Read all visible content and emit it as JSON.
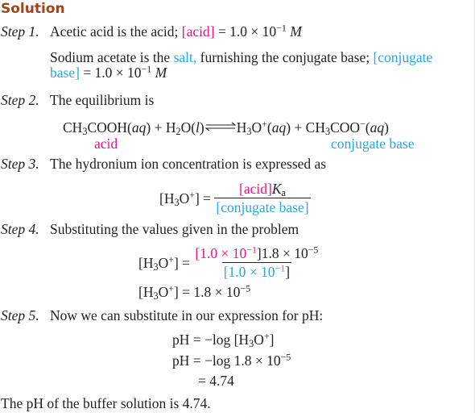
{
  "heading": "Solution",
  "steps": [
    {
      "label": "Step 1.",
      "line1": {
        "pre": "Acetic acid is the acid; ",
        "acid_term": "[acid]",
        "post": " = 1.0 × 10",
        "exp": "−1",
        "unit": "M"
      },
      "line2": {
        "pre": "Sodium acetate is the ",
        "salt": "salt,",
        "mid": " furnishing the conjugate base; ",
        "conj_term_a": "[conjugate",
        "conj_term_b": "base]",
        "post": " = 1.0 × 10",
        "exp": "−1",
        "unit": "M"
      }
    },
    {
      "label": "Step 2.",
      "text": "The equilibrium is",
      "equation": {
        "reactant1": "CH",
        "reactant1_sub": "3",
        "reactant1_rest": "COOH(",
        "aq": "aq",
        "close": ")",
        "plus": " + ",
        "reactant2": "H",
        "reactant2_sub": "2",
        "reactant2_rest": "O(",
        "l": "l",
        "product1": "H",
        "product1_sub": "3",
        "product1_rest": "O",
        "product1_sup": "+",
        "product1_state": "(",
        "product2": "CH",
        "product2_sub": "3",
        "product2_rest": "COO",
        "product2_sup": "−",
        "product2_state": "("
      },
      "acid_label": "acid",
      "base_label": "conjugate base"
    },
    {
      "label": "Step 3.",
      "text": "The hydronium ion concentration is expressed as",
      "lhs": "[H",
      "lhs_sub": "3",
      "lhs_o": "O",
      "lhs_sup": "+",
      "lhs_close": "] =",
      "num_acid": "[acid]",
      "num_k": "K",
      "num_k_sub": "a",
      "den": "[conjugate base]"
    },
    {
      "label": "Step 4.",
      "text": "Substituting the values given in the problem",
      "lhs": "[H",
      "lhs_sub": "3",
      "lhs_o": "O",
      "lhs_sup": "+",
      "lhs_close": "] =",
      "num_pink": "[1.0 × 10",
      "num_pink_exp": "−1",
      "num_rest": "]1.8 × 10",
      "num_rest_exp": "−5",
      "den_blue": "[1.0 × 10",
      "den_blue_exp": "−1",
      "den_close": "]",
      "result": "= 1.8 × 10",
      "result_exp": "−5"
    },
    {
      "label": "Step 5.",
      "text": "Now we can substitute in our expression for pH:",
      "line1_lhs": "pH",
      "line1_rhs": "= −log [H",
      "line1_sub": "3",
      "line1_o": "O",
      "line1_sup": "+",
      "line1_close": "]",
      "line2_lhs": "pH",
      "line2_rhs": "= −log 1.8 × 10",
      "line2_exp": "−5",
      "line3": "= 4.74"
    }
  ],
  "conclusion": "The pH of the buffer solution is 4.74.",
  "colors": {
    "heading": "#a0441b",
    "acid": "#e5147f",
    "base": "#2ba6e0",
    "text": "#231f20"
  }
}
